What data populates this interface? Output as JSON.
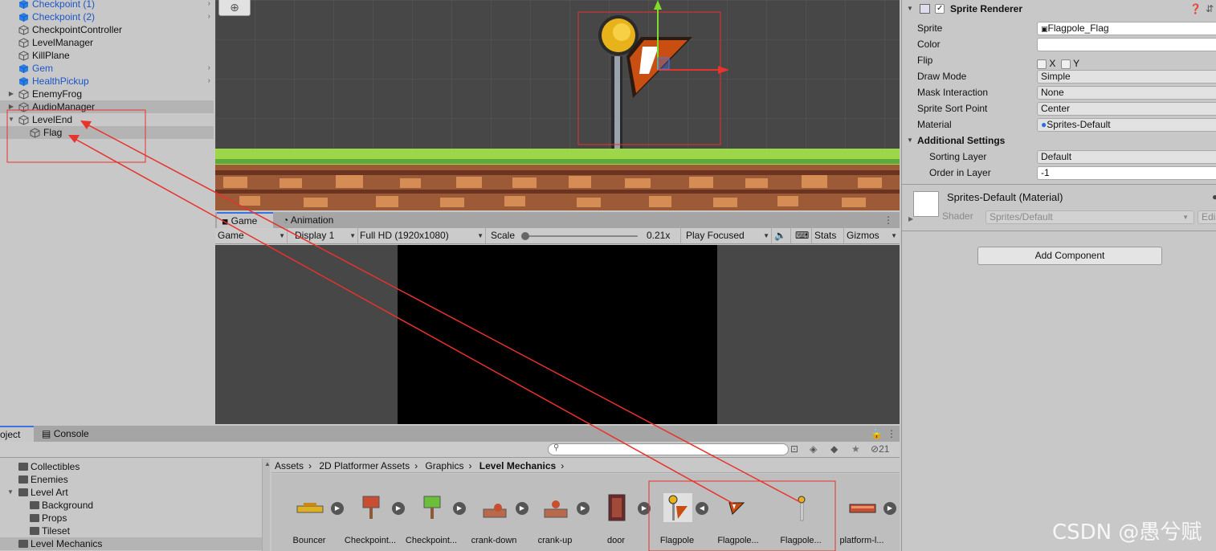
{
  "hierarchy": {
    "items": [
      {
        "label": "Checkpoint (1)",
        "prefab": true
      },
      {
        "label": "Checkpoint (2)",
        "prefab": true
      },
      {
        "label": "CheckpointController",
        "prefab": false
      },
      {
        "label": "LevelManager",
        "prefab": false
      },
      {
        "label": "KillPlane",
        "prefab": false
      },
      {
        "label": "Gem",
        "prefab": true
      },
      {
        "label": "HealthPickup",
        "prefab": true
      },
      {
        "label": "EnemyFrog",
        "prefab": false
      },
      {
        "label": "AudioManager",
        "prefab": false
      },
      {
        "label": "LevelEnd",
        "prefab": false
      },
      {
        "label": "Flag",
        "prefab": false
      }
    ]
  },
  "game_tabs": {
    "game": "Game",
    "animation": "Animation"
  },
  "game_toolbar": {
    "mode": "Game",
    "display": "Display 1",
    "resolution": "Full HD (1920x1080)",
    "scale_label": "Scale",
    "scale_value": "0.21x",
    "play_mode": "Play Focused",
    "stats": "Stats",
    "gizmos": "Gizmos"
  },
  "project_tabs": {
    "project": "oject",
    "console": "Console"
  },
  "project_toolbar": {
    "hidden_count": "21"
  },
  "folders": [
    {
      "label": "Collectibles"
    },
    {
      "label": "Enemies"
    },
    {
      "label": "Level Art"
    },
    {
      "label": "Background"
    },
    {
      "label": "Props"
    },
    {
      "label": "Tileset"
    },
    {
      "label": "Level Mechanics"
    }
  ],
  "breadcrumb": [
    "Assets",
    "2D Platformer Assets",
    "Graphics",
    "Level Mechanics"
  ],
  "assets": [
    {
      "name": "Bouncer"
    },
    {
      "name": "Checkpoint..."
    },
    {
      "name": "Checkpoint..."
    },
    {
      "name": "crank-down"
    },
    {
      "name": "crank-up"
    },
    {
      "name": "door"
    },
    {
      "name": "Flagpole"
    },
    {
      "name": "Flagpole..."
    },
    {
      "name": "Flagpole..."
    },
    {
      "name": "platform-l..."
    }
  ],
  "inspector": {
    "component_title": "Sprite Renderer",
    "fields": {
      "sprite_label": "Sprite",
      "sprite_value": "Flagpole_Flag",
      "color_label": "Color",
      "flip_label": "Flip",
      "flip_x": "X",
      "flip_y": "Y",
      "draw_mode_label": "Draw Mode",
      "draw_mode_value": "Simple",
      "mask_label": "Mask Interaction",
      "mask_value": "None",
      "sort_point_label": "Sprite Sort Point",
      "sort_point_value": "Center",
      "material_label": "Material",
      "material_value": "Sprites-Default"
    },
    "additional": {
      "title": "Additional Settings",
      "sorting_layer_label": "Sorting Layer",
      "sorting_layer_value": "Default",
      "order_label": "Order in Layer",
      "order_value": "-1"
    },
    "material": {
      "title": "Sprites-Default (Material)",
      "shader_label": "Shader",
      "shader_value": "Sprites/Default",
      "edit": "Edi"
    },
    "add_component": "Add Component"
  },
  "watermark": "CSDN @愚兮赋",
  "colors": {
    "annotation": "#e8322c",
    "prefab_text": "#1b55c9",
    "selection": "#b4b4b4"
  }
}
